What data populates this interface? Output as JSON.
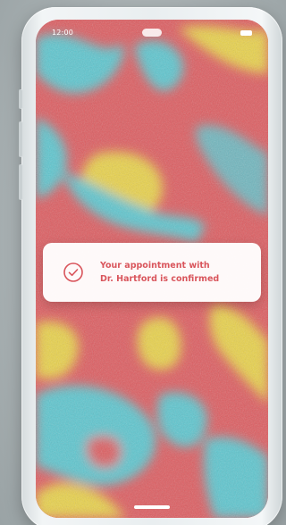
{
  "status_bar": {
    "time": "12:00",
    "battery_icon": "battery-icon"
  },
  "notification": {
    "icon": "check-circle-icon",
    "message": "Your appointment with\nDr. Hartford is confirmed",
    "accent_color": "#d9555c"
  },
  "colors": {
    "wallpaper_red": "#de5b5f",
    "wallpaper_yellow": "#e9d24a",
    "wallpaper_cyan": "#5cc6cf"
  }
}
